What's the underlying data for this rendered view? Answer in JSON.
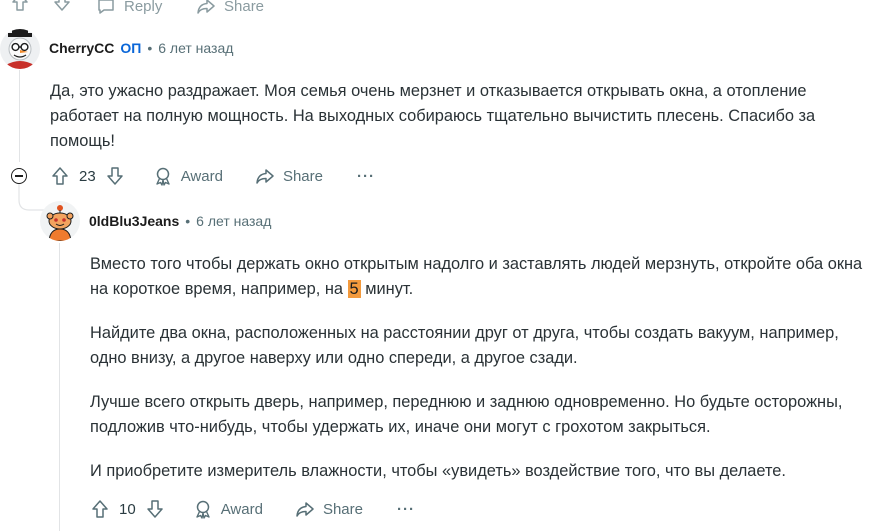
{
  "top_actions": {
    "reply_label": "Reply",
    "share_label": "Share"
  },
  "comment1": {
    "author": "CherryCC",
    "op_badge": "ОП",
    "dot": "•",
    "time": "6 лет назад",
    "text": "Да, это ужасно раздражает. Моя семья очень мерзнет и отказывается открывать окна, а отопление работает на полную мощность. На выходных собираюсь тщательно вычистить плесень. Спасибо за помощь!",
    "votes": "23",
    "award_label": "Award",
    "share_label": "Share",
    "more_label": "···"
  },
  "comment2": {
    "author": "0ldBlu3Jeans",
    "dot": "•",
    "time": "6 лет назад",
    "p1_before": "Вместо того чтобы держать окно открытым надолго и заставлять людей мерзнуть, откройте оба окна на короткое время, например, на ",
    "p1_highlight": "5",
    "p1_after": " минут.",
    "p2": "Найдите два окна, расположенных на расстоянии друг от друга, чтобы создать вакуум, например, одно внизу, а другое наверху или одно спереди, а другое сзади.",
    "p3": "Лучше всего открыть дверь, например, переднюю и заднюю одновременно. Но будьте осторожны, подложив что-нибудь, чтобы удержать их, иначе они могут с грохотом закрыться.",
    "p4": "И приобретите измеритель влажности, чтобы «увидеть» воздействие того, что вы делаете.",
    "votes": "10",
    "award_label": "Award",
    "share_label": "Share",
    "more_label": "···"
  }
}
